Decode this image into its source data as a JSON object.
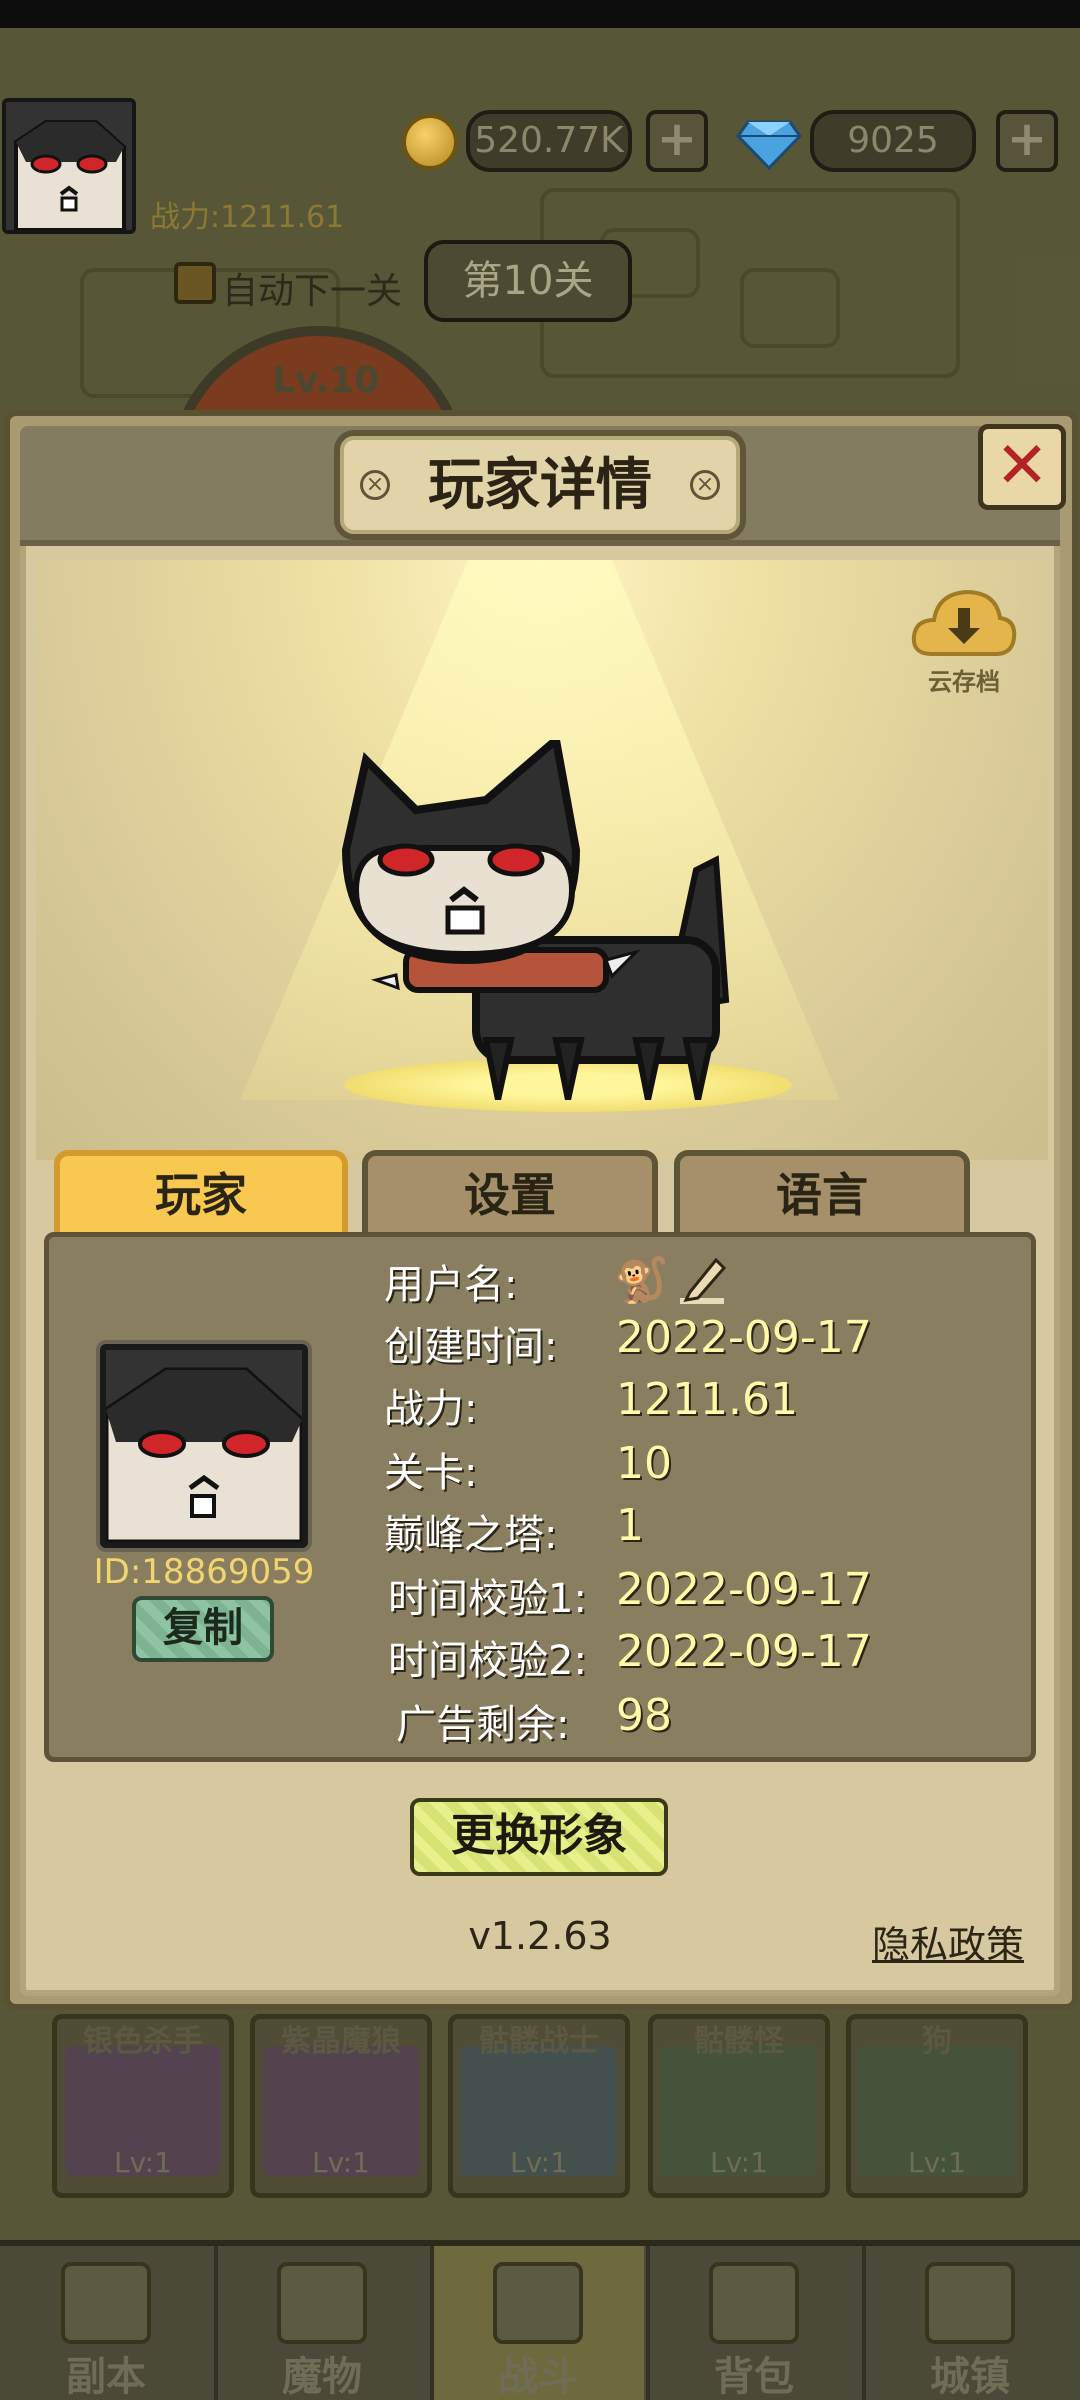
{
  "top_bar": {
    "coins": "520.77K",
    "gems": "9025",
    "plus_label": "+",
    "power": "战力:1211.61"
  },
  "stage": {
    "auto_next_label": "自动下一关",
    "stage_label": "第10关",
    "level_label": "Lv.10"
  },
  "modal": {
    "title": "玩家详情",
    "close_label": "✕",
    "cloud_save_label": "云存档",
    "tabs": [
      {
        "label": "玩家",
        "active": true
      },
      {
        "label": "设置",
        "active": false
      },
      {
        "label": "语言",
        "active": false
      }
    ],
    "player": {
      "id_text": "ID:18869059",
      "copy_label": "复制",
      "fields": [
        {
          "label": "用户名:",
          "value": ""
        },
        {
          "label": "创建时间:",
          "value": "2022-09-17"
        },
        {
          "label": "战力:",
          "value": "1211.61"
        },
        {
          "label": "关卡:",
          "value": "10"
        },
        {
          "label": "巅峰之塔:",
          "value": "1"
        },
        {
          "label": "时间校验1:",
          "value": "2022-09-17"
        },
        {
          "label": "时间校验2:",
          "value": "2022-09-17"
        },
        {
          "label": "广告剩余:",
          "value": "98"
        }
      ]
    },
    "change_avatar_label": "更换形象",
    "version": "v1.2.63",
    "privacy_label": "隐私政策"
  },
  "heroes": [
    {
      "name": "银色杀手",
      "level": "Lv:1",
      "color": "#5a3d63"
    },
    {
      "name": "紫晶魔狼",
      "level": "Lv:1",
      "color": "#5a3d63"
    },
    {
      "name": "骷髅战士",
      "level": "Lv:1",
      "color": "#3d5460"
    },
    {
      "name": "骷髅怪",
      "level": "Lv:1",
      "color": "#3d5a3d"
    },
    {
      "name": "狗",
      "level": "Lv:1",
      "color": "#3d5a3d"
    }
  ],
  "bottom_nav": [
    {
      "label": "副本",
      "icon": "map-icon"
    },
    {
      "label": "魔物",
      "icon": "monster-icon"
    },
    {
      "label": "战斗",
      "icon": "swords-icon",
      "active": true
    },
    {
      "label": "背包",
      "icon": "backpack-icon"
    },
    {
      "label": "城镇",
      "icon": "castle-icon"
    }
  ],
  "colors": {
    "tab_active": "#f8c850",
    "value_text": "#fff9a8",
    "id_text": "#f2d66d",
    "close_x": "#b32323"
  }
}
